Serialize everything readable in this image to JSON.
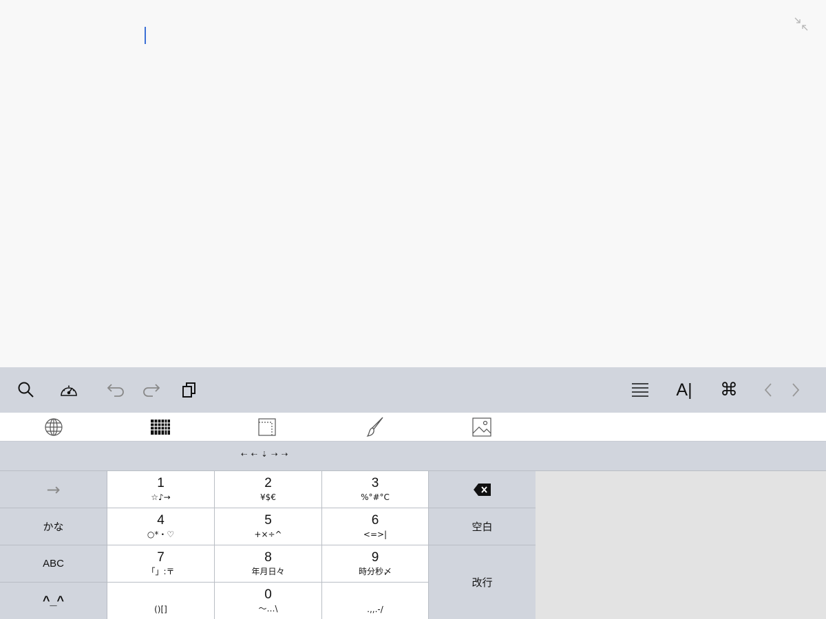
{
  "editor": {
    "caret": true,
    "minimize_icon": "minimize-arrows-icon"
  },
  "toolbar": {
    "left": [
      "search-icon",
      "speedometer-icon",
      "undo-icon",
      "redo-icon",
      "copy-icon"
    ],
    "right": [
      "align-justify-icon",
      "text-cursor-icon",
      "command-icon",
      "chevron-left-icon",
      "chevron-right-icon"
    ],
    "text_cursor_label": "A|",
    "command_glyph": "⌘"
  },
  "tabs": [
    "globe-icon",
    "keypad-grid-icon",
    "page-margin-icon",
    "brush-icon",
    "image-icon"
  ],
  "arrows_bar": {
    "label": "⇠ ⇠ ⇣ ⇢ ⇢"
  },
  "keyboard": {
    "left_col": {
      "tab_arrow": "→",
      "kana": "かな",
      "abc": "ABC",
      "emoticon": "^_^"
    },
    "keys": [
      {
        "main": "1",
        "sub": "☆♪→"
      },
      {
        "main": "2",
        "sub": "¥$€"
      },
      {
        "main": "3",
        "sub": "%°#°C"
      },
      {
        "main": "4",
        "sub": "○*・♡"
      },
      {
        "main": "5",
        "sub": "+×÷^"
      },
      {
        "main": "6",
        "sub": "<=>|"
      },
      {
        "main": "7",
        "sub": "「」:〒"
      },
      {
        "main": "8",
        "sub": "年月日々"
      },
      {
        "main": "9",
        "sub": "時分秒〆"
      },
      {
        "main": "",
        "sub": "()[]"
      },
      {
        "main": "0",
        "sub": "〜…\\"
      },
      {
        "main": "",
        "sub": ".,,.-/"
      }
    ],
    "right_col": {
      "backspace": "backspace-icon",
      "space": "空白",
      "return": "改行"
    }
  }
}
